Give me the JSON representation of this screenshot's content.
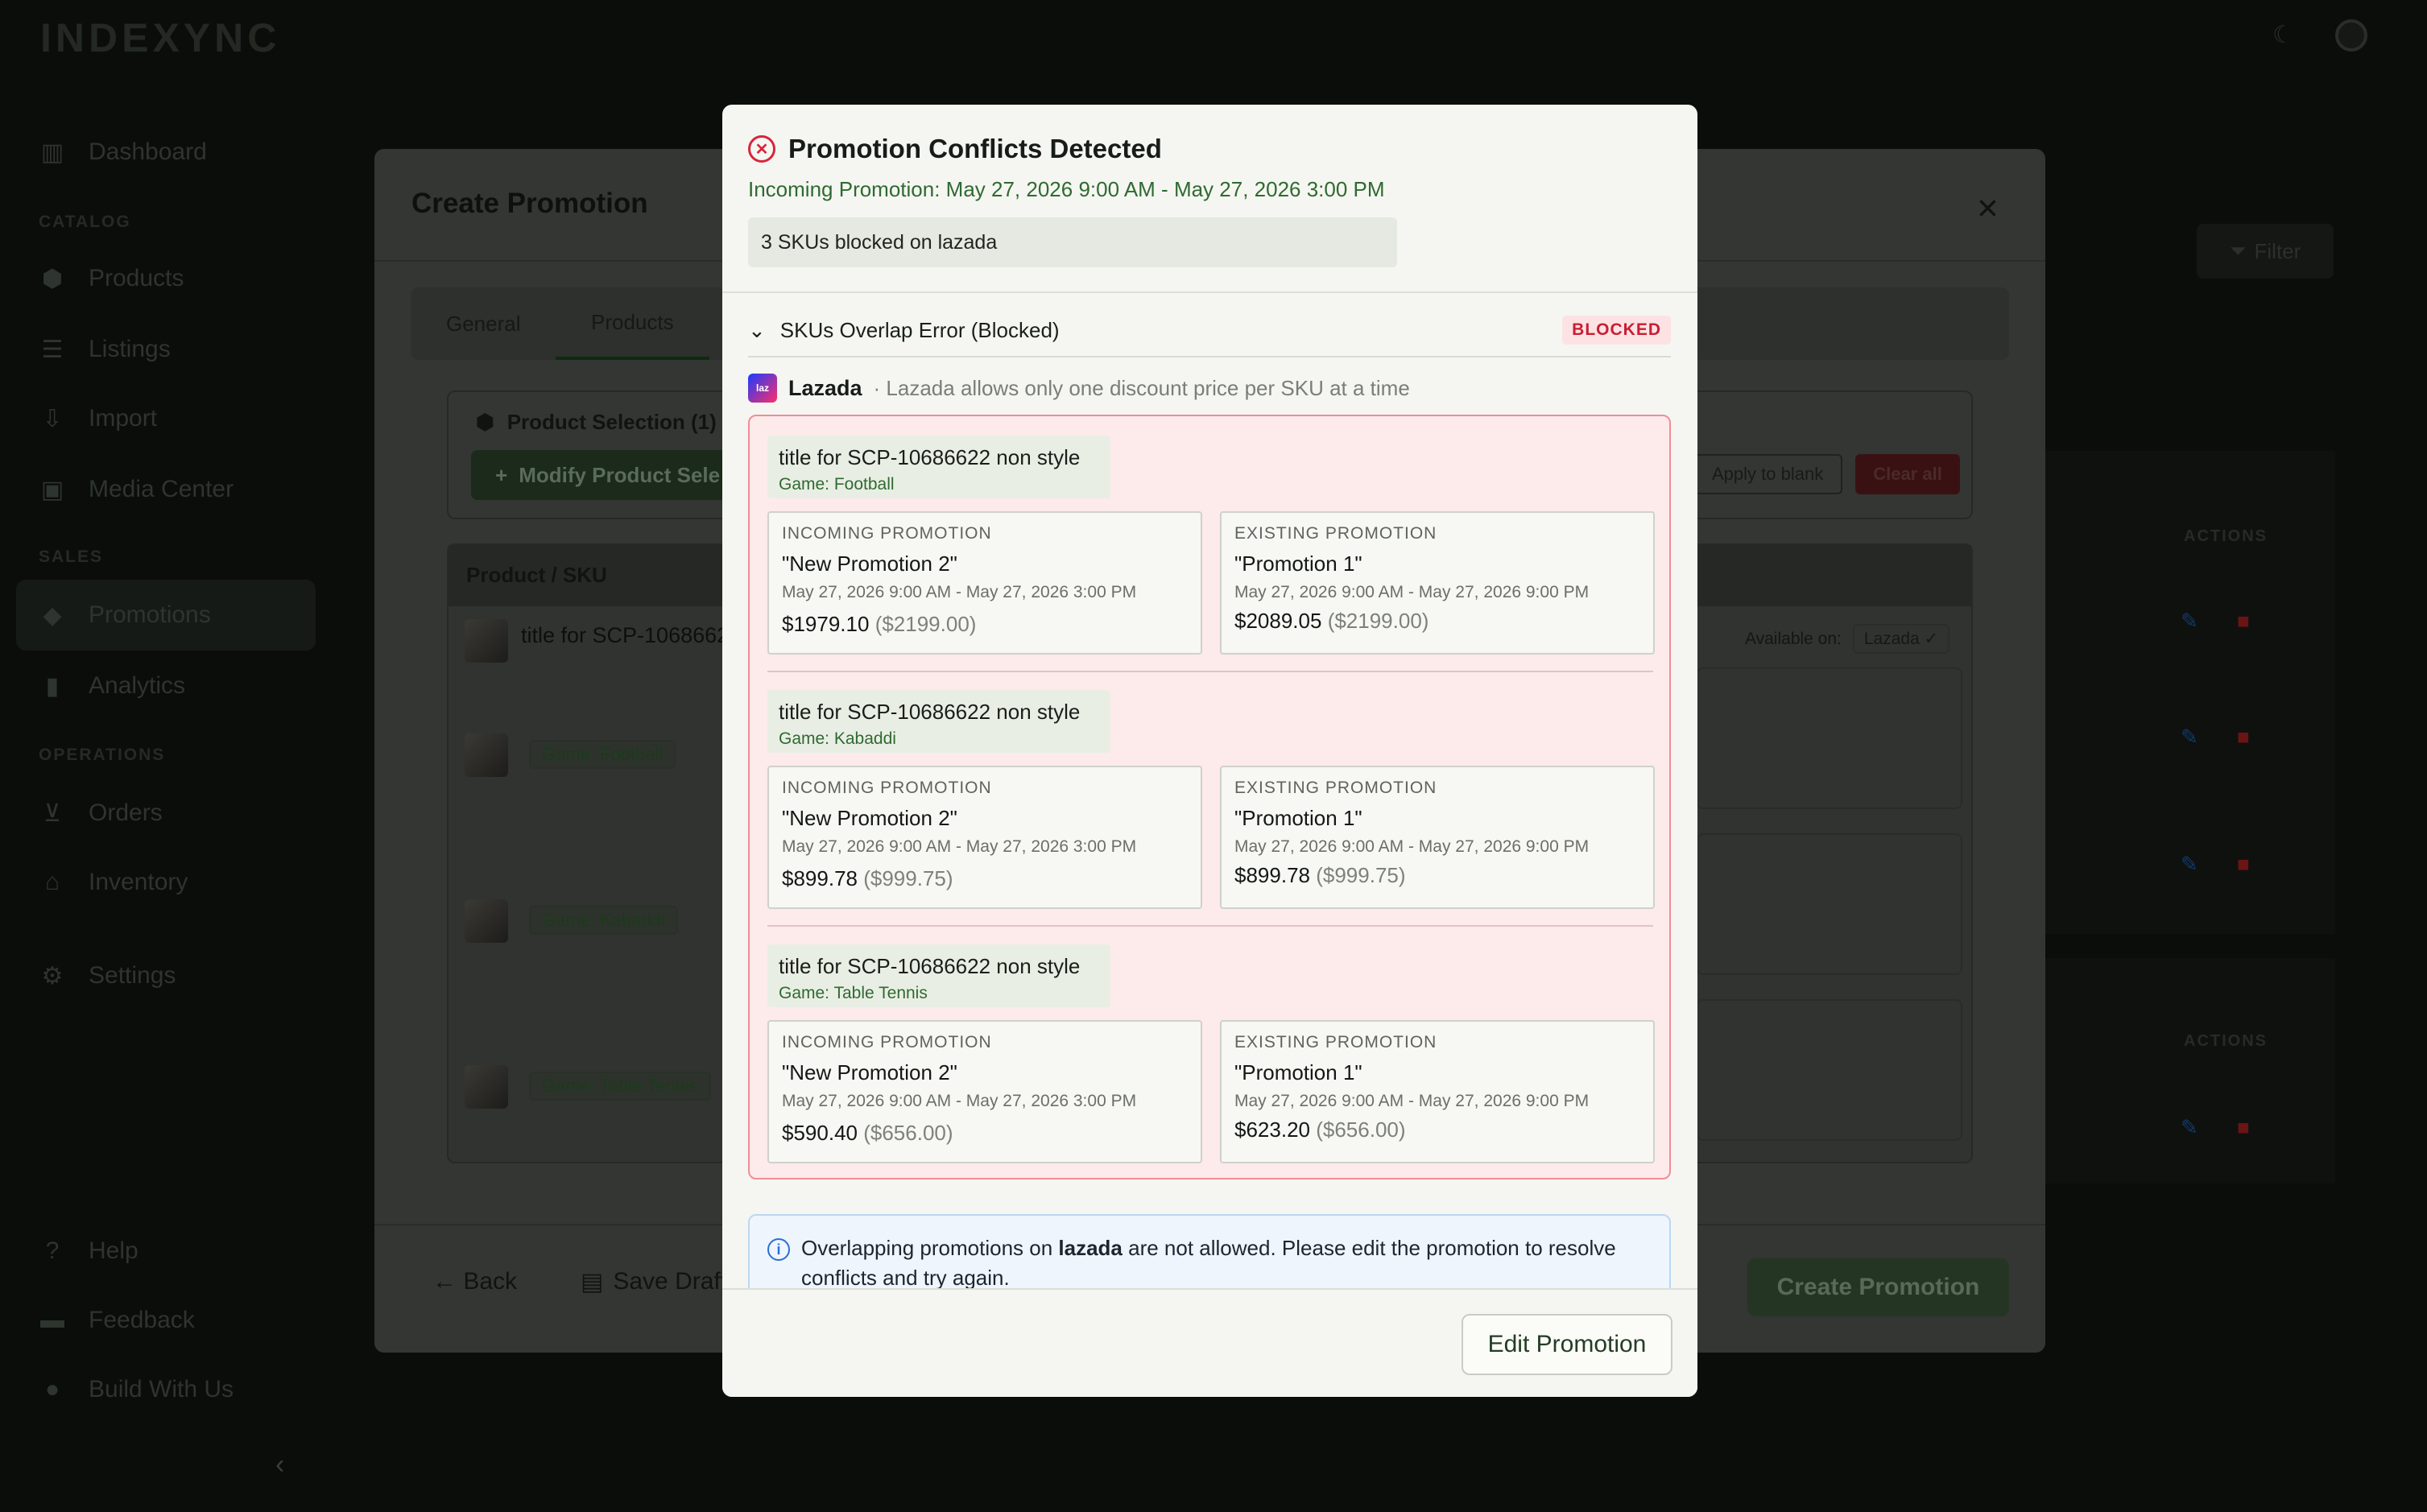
{
  "app": {
    "logo": "INDEXYNC"
  },
  "sidebar": {
    "items": [
      {
        "label": "Dashboard",
        "icon": "chart-icon"
      },
      {
        "label": "Products",
        "icon": "box-icon"
      },
      {
        "label": "Listings",
        "icon": "list-icon"
      },
      {
        "label": "Import",
        "icon": "import-icon"
      },
      {
        "label": "Media Center",
        "icon": "media-icon"
      },
      {
        "label": "Promotions",
        "icon": "tag-icon"
      },
      {
        "label": "Analytics",
        "icon": "analytics-icon"
      },
      {
        "label": "Orders",
        "icon": "cart-icon"
      },
      {
        "label": "Inventory",
        "icon": "warehouse-icon"
      },
      {
        "label": "Settings",
        "icon": "gear-icon"
      },
      {
        "label": "Help",
        "icon": "help-icon"
      },
      {
        "label": "Feedback",
        "icon": "chat-icon"
      },
      {
        "label": "Build With Us",
        "icon": "bulb-icon"
      }
    ],
    "sections": {
      "catalog": "CATALOG",
      "sales": "SALES",
      "operations": "OPERATIONS"
    }
  },
  "page": {
    "filter_label": "Filter",
    "actions_label": "ACTIONS"
  },
  "create_promotion": {
    "title": "Create Promotion",
    "tabs": [
      "General",
      "Products"
    ],
    "product_selection": "Product Selection (1)",
    "modify_button": "Modify Product Sele",
    "apply_blank": "Apply to blank",
    "clear_all": "Clear all",
    "table_header": "Product / SKU",
    "row_title": "title for SCP-1068662",
    "available_on": "Available on:",
    "available_platform": "Lazada",
    "variant_tags": [
      "Game: Football",
      "Game: Kabaddi",
      "Game: Table Tennis"
    ],
    "back": "Back",
    "save_draft": "Save Draft",
    "create_button": "Create Promotion"
  },
  "dialog": {
    "title": "Promotion Conflicts Detected",
    "incoming_range": "Incoming Promotion: May 27, 2026 9:00 AM - May 27, 2026 3:00 PM",
    "summary": "3 SKUs blocked on lazada",
    "section_title": "SKUs Overlap Error (Blocked)",
    "badge": "BLOCKED",
    "platform_name": "Lazada",
    "platform_note": "· Lazada allows only one discount price per SKU at a time",
    "incoming_label": "INCOMING PROMOTION",
    "existing_label": "EXISTING PROMOTION",
    "conflicts": [
      {
        "title": "title for SCP-10686622 non style",
        "variant": "Game: Football",
        "incoming": {
          "name": "\"New Promotion 2\"",
          "dates": "May 27, 2026 9:00 AM - May 27, 2026 3:00 PM",
          "price": "$1979.10",
          "original": "($2199.00)"
        },
        "existing": {
          "name": "\"Promotion 1\"",
          "dates": "May 27, 2026 9:00 AM - May 27, 2026 9:00 PM",
          "price": "$2089.05",
          "original": "($2199.00)"
        }
      },
      {
        "title": "title for SCP-10686622 non style",
        "variant": "Game: Kabaddi",
        "incoming": {
          "name": "\"New Promotion 2\"",
          "dates": "May 27, 2026 9:00 AM - May 27, 2026 3:00 PM",
          "price": "$899.78",
          "original": "($999.75)"
        },
        "existing": {
          "name": "\"Promotion 1\"",
          "dates": "May 27, 2026 9:00 AM - May 27, 2026 9:00 PM",
          "price": "$899.78",
          "original": "($999.75)"
        }
      },
      {
        "title": "title for SCP-10686622 non style",
        "variant": "Game: Table Tennis",
        "incoming": {
          "name": "\"New Promotion 2\"",
          "dates": "May 27, 2026 9:00 AM - May 27, 2026 3:00 PM",
          "price": "$590.40",
          "original": "($656.00)"
        },
        "existing": {
          "name": "\"Promotion 1\"",
          "dates": "May 27, 2026 9:00 AM - May 27, 2026 9:00 PM",
          "price": "$623.20",
          "original": "($656.00)"
        }
      }
    ],
    "info_pre": "Overlapping promotions on ",
    "info_platform": "lazada",
    "info_post": " are not allowed. Please edit the promotion to resolve conflicts and try again.",
    "edit_button": "Edit Promotion"
  }
}
